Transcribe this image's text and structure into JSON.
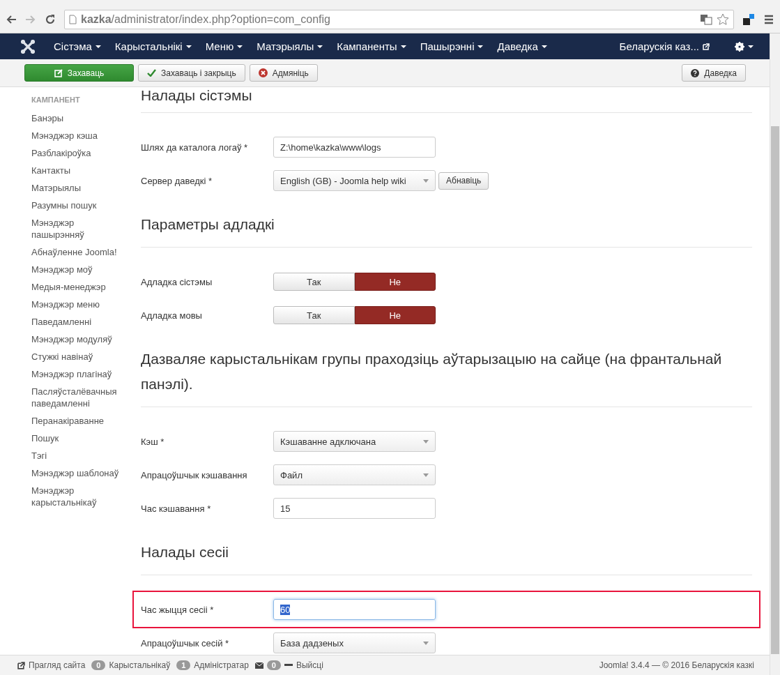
{
  "browser": {
    "url": "**kazka**/administrator/index.php?option=com_config"
  },
  "nav": {
    "menus": [
      {
        "label": "Сістэма"
      },
      {
        "label": "Карыстальнікі"
      },
      {
        "label": "Меню"
      },
      {
        "label": "Матэрыялы"
      },
      {
        "label": "Кампаненты"
      },
      {
        "label": "Пашырэнні"
      },
      {
        "label": "Даведка"
      }
    ],
    "site_link": "Беларускія каз..."
  },
  "toolbar": {
    "buttons": [
      {
        "kind": "save",
        "label": "Захаваць"
      },
      {
        "kind": "save_close",
        "label": "Захаваць і закрыць"
      },
      {
        "kind": "cancel",
        "label": "Адмяніць"
      }
    ],
    "help": "Даведка"
  },
  "sidebar": {
    "heading": "КАМПАНЕНТ",
    "items": [
      "Банэры",
      "Мэнэджэр кэша",
      "Разблакіроўка",
      "Кантакты",
      "Матэрыялы",
      "Разумны пошук",
      "Мэнэджэр пашырэнняў",
      "Абнаўленне Joomla!",
      "Мэнэджэр моў",
      "Медыя-менеджэр",
      "Мэнэджэр меню",
      "Паведамленні",
      "Мэнэджэр модуляў",
      "Стужкі навінаў",
      "Мэнэджэр плагінаў",
      "Пасляўсталёвачныя паведамленні",
      "Перанакіраванне",
      "Пошук",
      "Тэгі",
      "Мэнэджэр шаблонаў",
      "Мэнэджэр карыстальнікаў"
    ]
  },
  "sections": [
    {
      "title": "Налады сістэмы",
      "fields": [
        {
          "kind": "text",
          "label": "Шлях да каталога логаў *",
          "value": "Z:\\home\\kazka\\www\\logs"
        },
        {
          "kind": "select_button",
          "label": "Сервер даведкі *",
          "value": "English (GB) - Joomla help wiki",
          "button": "Абнавіць"
        }
      ]
    },
    {
      "title": "Параметры адладкі",
      "fields": [
        {
          "kind": "toggle",
          "label": "Адладка сістэмы",
          "options": [
            {
              "label": "Так",
              "selected": false
            },
            {
              "label": "Не",
              "selected": true
            }
          ]
        },
        {
          "kind": "toggle",
          "label": "Адладка мовы",
          "options": [
            {
              "label": "Так",
              "selected": false
            },
            {
              "label": "Не",
              "selected": true
            }
          ]
        }
      ]
    },
    {
      "title": "Дазваляе карыстальнікам групы праходзіць аўтарызацыю на сайце (на франтальнай панэлі).",
      "fields": [
        {
          "kind": "select",
          "label": "Кэш *",
          "value": "Кэшаванне адключана"
        },
        {
          "kind": "select",
          "label": "Апрацоўшчык кэшавання",
          "value": "Файл"
        },
        {
          "kind": "text",
          "label": "Час кэшавання *",
          "value": "15"
        }
      ]
    },
    {
      "title": "Налады сесіі",
      "fields": [
        {
          "kind": "text",
          "label": "Час жыцця сесіі *",
          "value": "60",
          "highlighted": true,
          "text_selected": true
        },
        {
          "kind": "select",
          "label": "Апрацоўшчык сесій *",
          "value": "База дадзеных"
        }
      ]
    }
  ],
  "footer": {
    "items": [
      {
        "kind": "link",
        "label": "Прагляд сайта"
      },
      {
        "kind": "count",
        "count": "0",
        "label": "Карыстальнікаў"
      },
      {
        "kind": "count",
        "count": "1",
        "label": "Адміністратар"
      },
      {
        "kind": "mail",
        "count": "0"
      },
      {
        "kind": "logout",
        "label": "Выйсці"
      }
    ],
    "right": "Joomla! 3.4.4 — © 2016 Беларускія казкі"
  }
}
